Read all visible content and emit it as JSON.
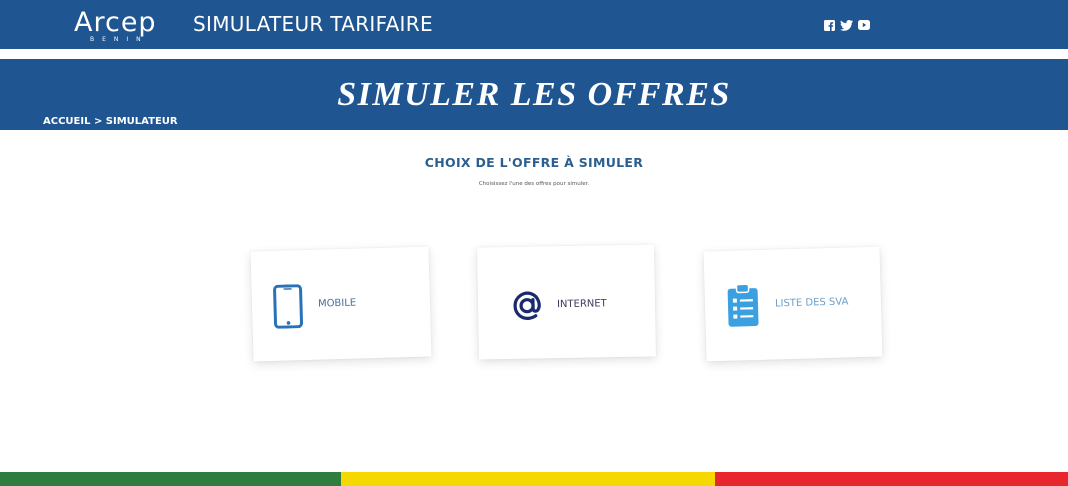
{
  "header": {
    "logo_text": "Arcep",
    "logo_subtext": "BENIN",
    "app_title": "SIMULATEUR TARIFAIRE",
    "social_icons": [
      "facebook-icon",
      "twitter-icon",
      "youtube-icon"
    ]
  },
  "hero": {
    "title": "SIMULER LES OFFRES",
    "breadcrumb": "ACCUEIL > SIMULATEUR"
  },
  "section": {
    "title": "CHOIX DE L'OFFRE À SIMULER",
    "subtitle": "Choisissez l'une des offres pour simuler."
  },
  "offers": [
    {
      "label": "MOBILE",
      "icon": "smartphone-icon"
    },
    {
      "label": "INTERNET",
      "icon": "at-sign-icon"
    },
    {
      "label": "LISTE DES SVA",
      "icon": "clipboard-list-icon"
    }
  ],
  "colors": {
    "brand_blue": "#1f5591",
    "flag_green": "#2e7d3f",
    "flag_yellow": "#f5d800",
    "flag_red": "#e8262d"
  }
}
